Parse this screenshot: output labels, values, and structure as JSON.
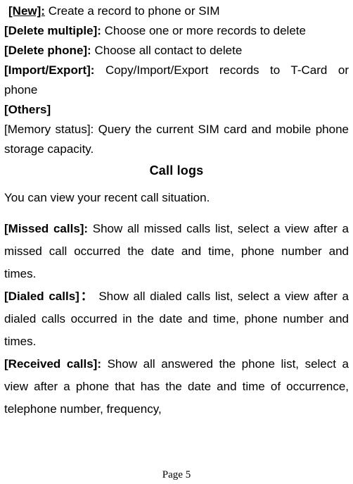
{
  "items": {
    "new": {
      "label": "[New]:",
      "desc": "Create a record to phone or SIM"
    },
    "delete_multiple": {
      "label": "[Delete multiple]:",
      "desc": "Choose one or more records to delete"
    },
    "delete_phone": {
      "label": "[Delete phone]:",
      "desc": "Choose all contact to delete"
    },
    "import_export": {
      "label": "[Import/Export]:",
      "desc_line1": "Copy/Import/Export records to T-Card or",
      "desc_line2": "phone"
    },
    "others": {
      "label": "[Others]"
    },
    "memory_status": {
      "text": "[Memory status]: Query the current SIM card and mobile phone storage capacity."
    }
  },
  "heading": "Call logs",
  "intro": "You can view your recent call situation.",
  "missed": {
    "label": "[Missed calls]:",
    "desc": "Show all missed calls list, select a view after a missed call occurred the date and time, phone number and times."
  },
  "dialed": {
    "label": "[Dialed calls]：",
    "desc": "Show all dialed calls list, select a view after a dialed calls occurred in the date and time, phone number and times."
  },
  "received": {
    "label": "[Received calls]:",
    "desc": "Show all answered the phone list, select a view after a phone that has the date and time of occurrence, telephone number, frequency,"
  },
  "footer": "Page 5"
}
